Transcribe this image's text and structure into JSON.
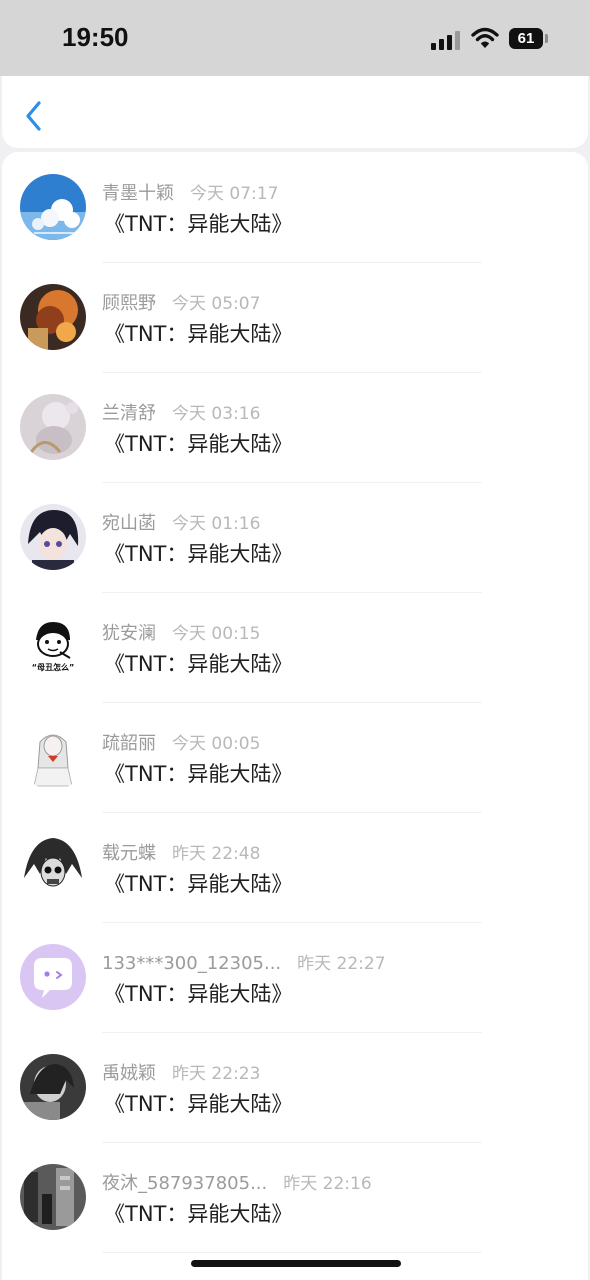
{
  "status_bar": {
    "time": "19:50",
    "battery": "61"
  },
  "nav": {
    "back_icon": "chevron-left-icon"
  },
  "messages": [
    {
      "name": "青墨十颖",
      "time": "今天 07:17",
      "text": "《TNT：异能大陆》"
    },
    {
      "name": "顾熙野",
      "time": "今天 05:07",
      "text": "《TNT：异能大陆》"
    },
    {
      "name": "兰清舒",
      "time": "今天 03:16",
      "text": "《TNT：异能大陆》"
    },
    {
      "name": "宛山菡",
      "time": "今天 01:16",
      "text": "《TNT：异能大陆》"
    },
    {
      "name": "犹安澜",
      "time": "今天 00:15",
      "text": "《TNT：异能大陆》",
      "avatar_text": "“母丑怎么”"
    },
    {
      "name": "疏韶丽",
      "time": "今天 00:05",
      "text": "《TNT：异能大陆》"
    },
    {
      "name": "载元蝶",
      "time": "昨天 22:48",
      "text": "《TNT：异能大陆》"
    },
    {
      "name": "133***300_12305...",
      "time": "昨天 22:27",
      "text": "《TNT：异能大陆》"
    },
    {
      "name": "禹娀颖",
      "time": "昨天 22:23",
      "text": "《TNT：异能大陆》"
    },
    {
      "name": "夜沐_587937805...",
      "time": "昨天 22:16",
      "text": "《TNT：异能大陆》"
    }
  ],
  "colors": {
    "accent": "#2a8fe6",
    "name_gray": "#9b9b9b",
    "time_gray": "#b8b8b8",
    "text_dark": "#1e1e1e"
  }
}
